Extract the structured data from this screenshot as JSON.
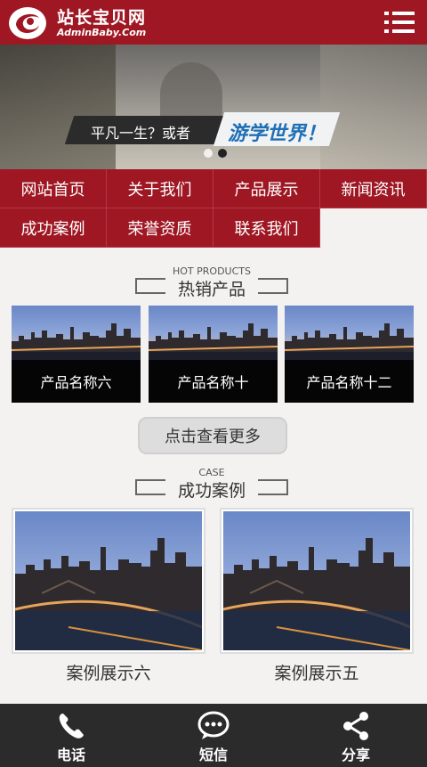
{
  "header": {
    "logo_cn": "站长宝贝网",
    "logo_en": "AdminBaby.Com",
    "menu_icon": "hamburger-menu-icon"
  },
  "banner": {
    "slogan_part1": "平凡一生？或者",
    "slogan_part2": "游学世界！",
    "slide_count": 2,
    "active_slide": 2
  },
  "nav": {
    "items": [
      {
        "label": "网站首页"
      },
      {
        "label": "关于我们"
      },
      {
        "label": "产品展示"
      },
      {
        "label": "新闻资讯"
      },
      {
        "label": "成功案例"
      },
      {
        "label": "荣誉资质"
      },
      {
        "label": "联系我们"
      }
    ]
  },
  "hot_products": {
    "title_en": "HOT PRODUCTS",
    "title_cn": "热销产品",
    "items": [
      {
        "name": "产品名称六"
      },
      {
        "name": "产品名称十"
      },
      {
        "name": "产品名称十二"
      }
    ],
    "more_label": "点击查看更多"
  },
  "cases": {
    "title_en": "CASE",
    "title_cn": "成功案例",
    "items": [
      {
        "name": "案例展示六"
      },
      {
        "name": "案例展示五"
      }
    ]
  },
  "bottom_bar": {
    "items": [
      {
        "label": "电话",
        "icon": "phone-icon"
      },
      {
        "label": "短信",
        "icon": "chat-bubble-icon"
      },
      {
        "label": "分享",
        "icon": "share-icon"
      }
    ]
  },
  "colors": {
    "brand_red": "#9e1723",
    "bottom_bar": "#2b2b2b",
    "page_bg": "#f4f1f1"
  }
}
